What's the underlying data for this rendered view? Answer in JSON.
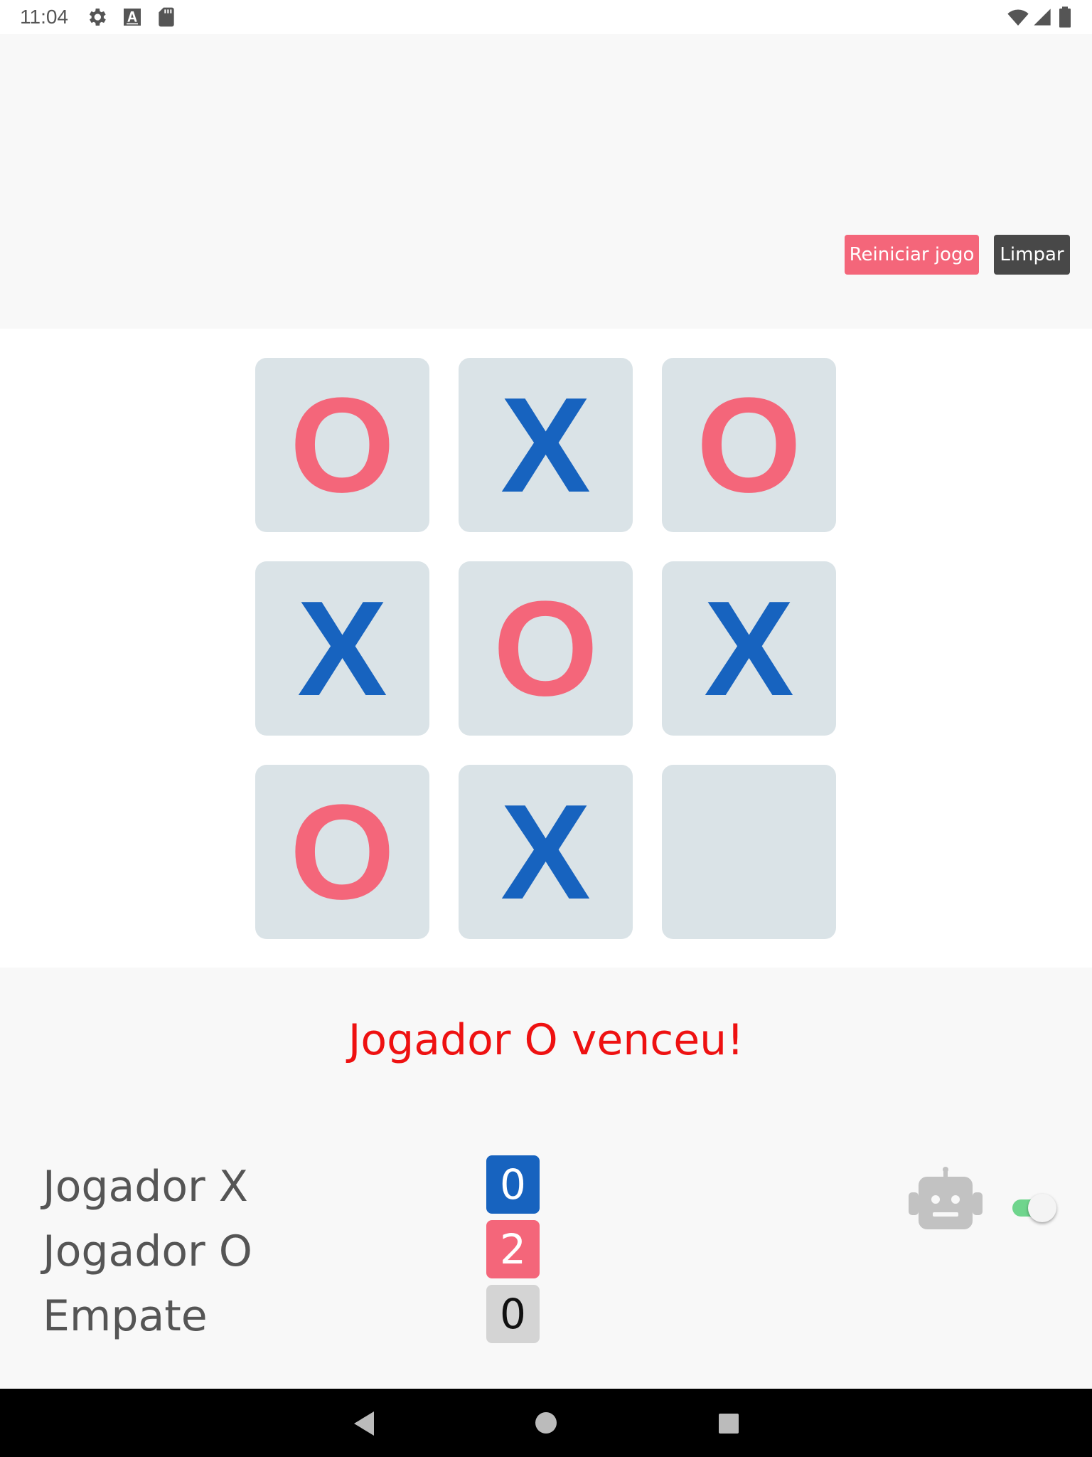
{
  "status_bar": {
    "time": "11:04",
    "icons_left": [
      "settings-icon",
      "keyboard-a-icon",
      "sd-card-icon"
    ],
    "icons_right": [
      "wifi-icon",
      "cellular-signal-icon",
      "battery-icon"
    ]
  },
  "controls": {
    "restart_label": "Reiniciar jogo",
    "clear_label": "Limpar"
  },
  "board": {
    "cells": [
      "O",
      "X",
      "O",
      "X",
      "O",
      "X",
      "O",
      "X",
      ""
    ]
  },
  "result_text": "Jogador O venceu!",
  "scoreboard": {
    "player_x": {
      "label": "Jogador X",
      "score": "0"
    },
    "player_o": {
      "label": "Jogador O",
      "score": "2"
    },
    "draw": {
      "label": "Empate",
      "score": "0"
    }
  },
  "ai_mode": {
    "icon": "robot-icon",
    "enabled": true
  },
  "colors": {
    "o_mark": "#f4667a",
    "x_mark": "#1763bf",
    "cell_bg": "#dae3e7",
    "result_text": "#ee1111",
    "toggle_on": "#6fd58d"
  },
  "nav_bar": {
    "buttons": [
      "back-icon",
      "home-icon",
      "recents-icon"
    ]
  }
}
